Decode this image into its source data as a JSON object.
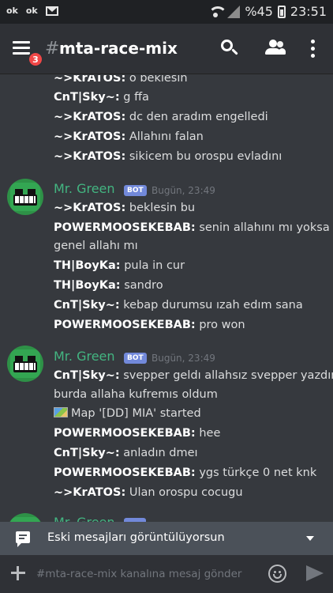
{
  "status_bar": {
    "left_items": [
      "ok",
      "ok"
    ],
    "battery": "%45",
    "time": "23:51"
  },
  "header": {
    "badge_count": "3",
    "hash": "#",
    "channel": "mta-race-mix"
  },
  "messages": {
    "top_lines": [
      {
        "author": "~>KrATOS:",
        "text": " o beklesin"
      },
      {
        "author": "CnT|Sky~:",
        "text": " g ffa"
      },
      {
        "author": "~>KrATOS:",
        "text": " dc den aradım engelledi"
      },
      {
        "author": "~>KrATOS:",
        "text": " Allahını falan"
      },
      {
        "author": "~>KrATOS:",
        "text": " sikicem bu orospu evladını"
      }
    ],
    "group1": {
      "username": "Mr. Green",
      "bot_tag": "BOT",
      "timestamp": "Bugün, 23:49",
      "lines": [
        {
          "author": "~>KrATOS:",
          "text": " beklesin bu"
        },
        {
          "author": "POWERMOOSEKEBAB:",
          "text": " senin allahını mı yoksa"
        },
        {
          "author": "",
          "text": "genel allahı mı"
        },
        {
          "author": "TH|BoyKa:",
          "text": " pula in cur"
        },
        {
          "author": "TH|BoyKa:",
          "text": " sandro"
        },
        {
          "author": "CnT|Sky~:",
          "text": " kebap durumsu ızah edım sana"
        },
        {
          "author": "POWERMOOSEKEBAB:",
          "text": " pro won"
        }
      ]
    },
    "group2": {
      "username": "Mr. Green",
      "bot_tag": "BOT",
      "timestamp": "Bugün, 23:49",
      "lines": [
        {
          "author": "CnT|Sky~:",
          "text": " svepper geldı allahsız svepper  yazdım"
        },
        {
          "author": "",
          "text": "burda allaha kufremıs oldum"
        },
        {
          "author": "",
          "text": "Map '[DD] MIA' started"
        },
        {
          "author": "POWERMOOSEKEBAB:",
          "text": " hee"
        },
        {
          "author": "CnT|Sky~:",
          "text": " anladın dmeı"
        },
        {
          "author": "POWERMOOSEKEBAB:",
          "text": " ygs türkçe 0 net knk"
        },
        {
          "author": "~>KrATOS:",
          "text": " Ulan orospu cocugu"
        }
      ]
    },
    "group3": {
      "username": "Mr. Green"
    }
  },
  "old_messages_bar": {
    "label": "Eski mesajları görüntülüyorsun"
  },
  "composer": {
    "placeholder": "#mta-race-mix kanalına mesaj gönder"
  },
  "colors": {
    "username_green": "#43b581",
    "bot_tag": "#7289da",
    "badge_red": "#f04747",
    "background": "#36393e"
  }
}
